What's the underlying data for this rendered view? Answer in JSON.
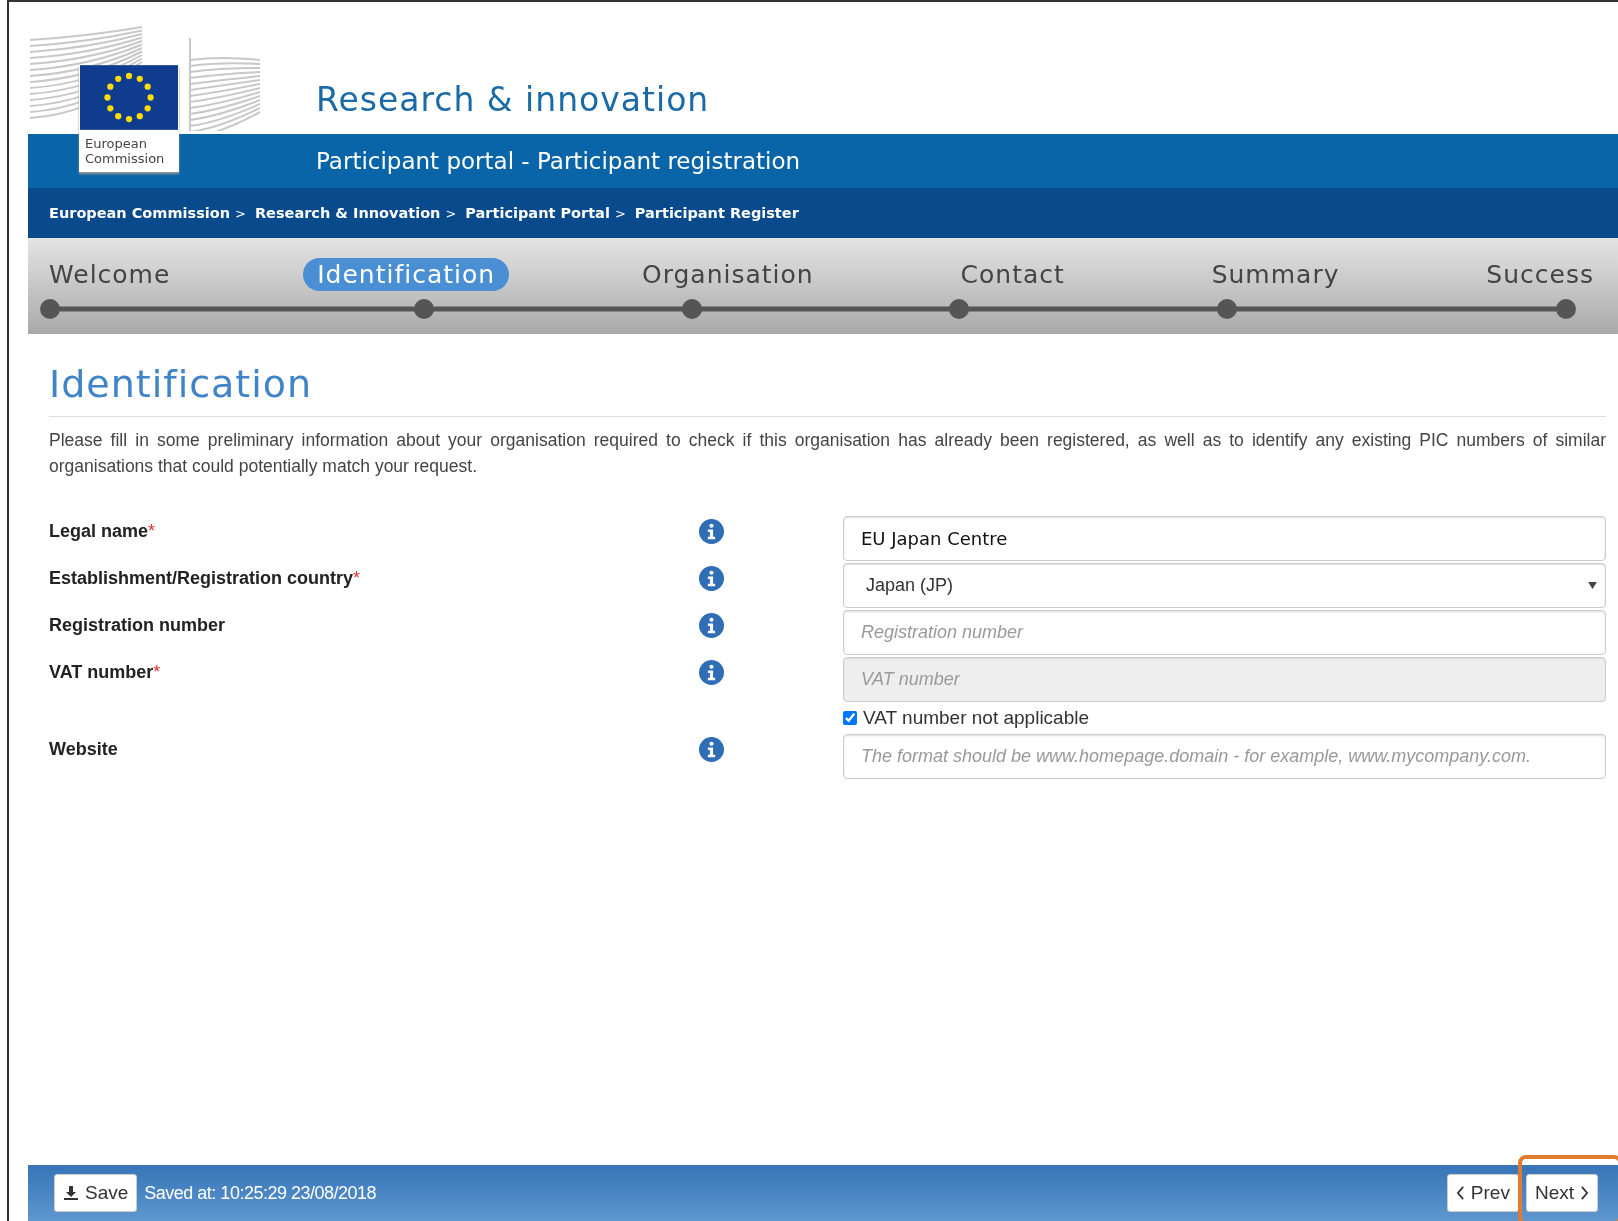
{
  "header": {
    "logo_text": [
      "European",
      "Commission"
    ],
    "site_title": "Research & innovation",
    "portal_title": "Participant portal - Participant registration"
  },
  "breadcrumb": [
    "European Commission",
    "Research & Innovation",
    "Participant Portal",
    "Participant Register"
  ],
  "breadcrumb_separator": ">",
  "steps": [
    {
      "label": "Welcome",
      "selected": false
    },
    {
      "label": "Identification",
      "selected": true
    },
    {
      "label": "Organisation",
      "selected": false
    },
    {
      "label": "Contact",
      "selected": false
    },
    {
      "label": "Summary",
      "selected": false
    },
    {
      "label": "Success",
      "selected": false
    }
  ],
  "page_title": "Identification",
  "intro": "Please fill in some preliminary information about your organisation required to check if this organisation has already been registered, as well as to identify any existing PIC numbers of similar organisations that could potentially match your request.",
  "form": [
    {
      "kind": "text",
      "label": "Legal name",
      "required": true,
      "value": "EU Japan Centre"
    },
    {
      "kind": "select",
      "label": "Establishment/Registration country",
      "required": true,
      "value": "Japan (JP)"
    },
    {
      "kind": "text",
      "label": "Registration number",
      "required": false,
      "placeholder": "Registration number"
    },
    {
      "kind": "text",
      "label": "VAT number",
      "required": true,
      "placeholder": "VAT number",
      "disabled": true
    },
    {
      "kind": "checkbox",
      "label": "VAT number not applicable",
      "checked": true
    },
    {
      "kind": "text",
      "label": "Website",
      "required": false,
      "placeholder": "The format should be www.homepage.domain - for example, www.mycompany.com."
    }
  ],
  "required_mark": "*",
  "footer": {
    "save": "Save",
    "saved_at": "Saved at: 10:25:29 23/08/2018",
    "prev": "Prev",
    "next": "Next",
    "next_highlighted": true
  }
}
